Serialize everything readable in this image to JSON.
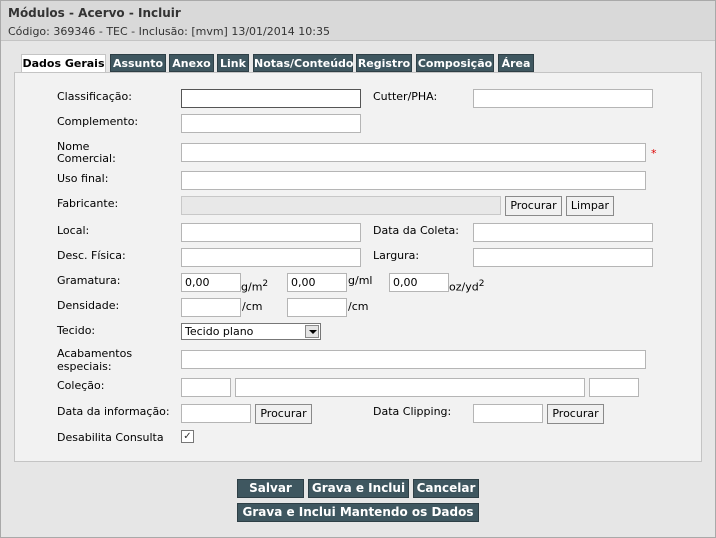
{
  "header": {
    "title": "Módulos - Acervo - Incluir",
    "subtitle": "Código: 369346 - TEC - Inclusão: [mvm] 13/01/2014 10:35"
  },
  "tabs": [
    {
      "label": "Dados Gerais"
    },
    {
      "label": "Assunto"
    },
    {
      "label": "Anexo"
    },
    {
      "label": "Link"
    },
    {
      "label": "Notas/Conteúdo"
    },
    {
      "label": "Registro"
    },
    {
      "label": "Composição"
    },
    {
      "label": "Área"
    }
  ],
  "form": {
    "classificacao": {
      "label": "Classificação:",
      "value": ""
    },
    "cutter": {
      "label": "Cutter/PHA:",
      "value": ""
    },
    "complemento": {
      "label": "Complemento:",
      "value": ""
    },
    "nome_comercial": {
      "label_line1": "Nome",
      "label_line2": "Comercial:",
      "value": "",
      "required_mark": "*"
    },
    "uso_final": {
      "label": "Uso final:",
      "value": ""
    },
    "fabricante": {
      "label": "Fabricante:",
      "value": "",
      "search_label": "Procurar",
      "clear_label": "Limpar"
    },
    "local": {
      "label": "Local:",
      "value": ""
    },
    "data_coleta": {
      "label": "Data da Coleta:",
      "value": ""
    },
    "desc_fisica": {
      "label": "Desc. Física:",
      "value": ""
    },
    "largura": {
      "label": "Largura:",
      "value": ""
    },
    "gramatura": {
      "label": "Gramatura:",
      "v1": "0,00",
      "u1": "g/m",
      "u1_sup": "2",
      "v2": "0,00",
      "u2": "g/ml",
      "v3": "0,00",
      "u3": "oz/yd",
      "u3_sup": "2"
    },
    "densidade": {
      "label": "Densidade:",
      "v1": "",
      "u1": "/cm",
      "v2": "",
      "u2": "/cm"
    },
    "tecido": {
      "label": "Tecido:",
      "selected": "Tecido plano"
    },
    "acabamentos": {
      "label_line1": "Acabamentos",
      "label_line2": "especiais:",
      "value": ""
    },
    "colecao": {
      "label": "Coleção:",
      "v1": "",
      "v2": "",
      "v3": ""
    },
    "data_informacao": {
      "label": "Data da informação:",
      "value": "",
      "search_label": "Procurar"
    },
    "data_clipping": {
      "label": "Data Clipping:",
      "value": "",
      "search_label": "Procurar"
    },
    "desabilita": {
      "label": "Desabilita Consulta",
      "checked_mark": "✓"
    }
  },
  "actions": {
    "save": "Salvar",
    "save_new": "Grava e Inclui",
    "cancel": "Cancelar",
    "save_keep": "Grava e Inclui Mantendo os Dados"
  },
  "colors": {
    "tab_bg": "#3f5760",
    "panel_bg": "#f2f2f2",
    "required": "#dd0000"
  }
}
